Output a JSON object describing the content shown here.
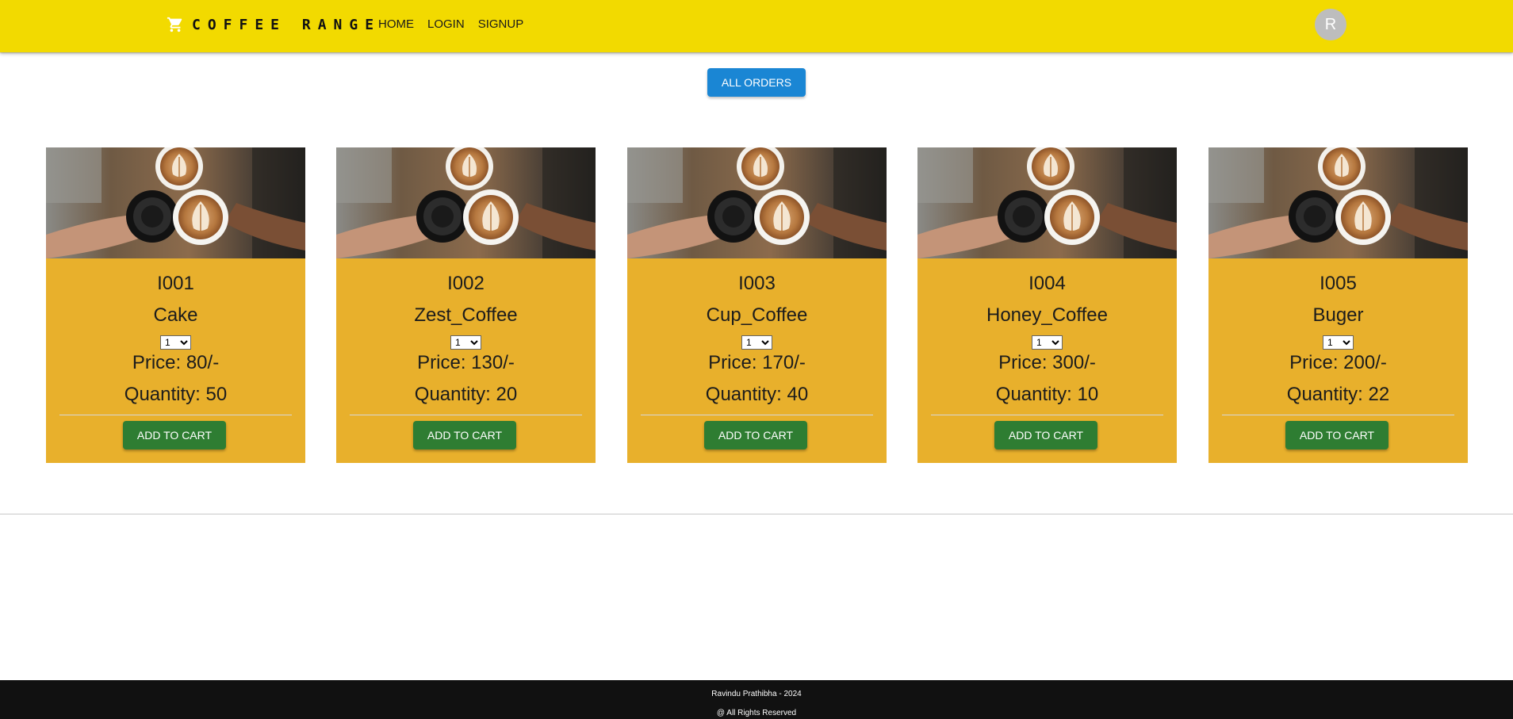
{
  "theme": {
    "header_bg": "#f2da00",
    "card_bg": "#e8b02c",
    "button_blue": "#1a86d4",
    "button_green": "#2e7d32",
    "footer_bg": "#111111"
  },
  "header": {
    "brand_icon": "shopping-cart-icon",
    "brand": "COFFEE RANGE",
    "nav": [
      "HOME",
      "LOGIN",
      "SIGNUP"
    ],
    "avatar_letter": "R"
  },
  "main": {
    "all_orders_label": "ALL ORDERS",
    "products": [
      {
        "id": "I001",
        "name": "Cake",
        "select_value": "1",
        "price": "Price: 80/-",
        "quantity": "Quantity: 50",
        "button": "ADD TO CART"
      },
      {
        "id": "I002",
        "name": "Zest_Coffee",
        "select_value": "1",
        "price": "Price: 130/-",
        "quantity": "Quantity: 20",
        "button": "ADD TO CART"
      },
      {
        "id": "I003",
        "name": "Cup_Coffee",
        "select_value": "1",
        "price": "Price: 170/-",
        "quantity": "Quantity: 40",
        "button": "ADD TO CART"
      },
      {
        "id": "I004",
        "name": "Honey_Coffee",
        "select_value": "1",
        "price": "Price: 300/-",
        "quantity": "Quantity: 10",
        "button": "ADD TO CART"
      },
      {
        "id": "I005",
        "name": "Buger",
        "select_value": "1",
        "price": "Price: 200/-",
        "quantity": "Quantity: 22",
        "button": "ADD TO CART"
      }
    ]
  },
  "footer": {
    "line1": "Ravindu Prathibha - 2024",
    "line2": "@ All Rights Reserved"
  }
}
